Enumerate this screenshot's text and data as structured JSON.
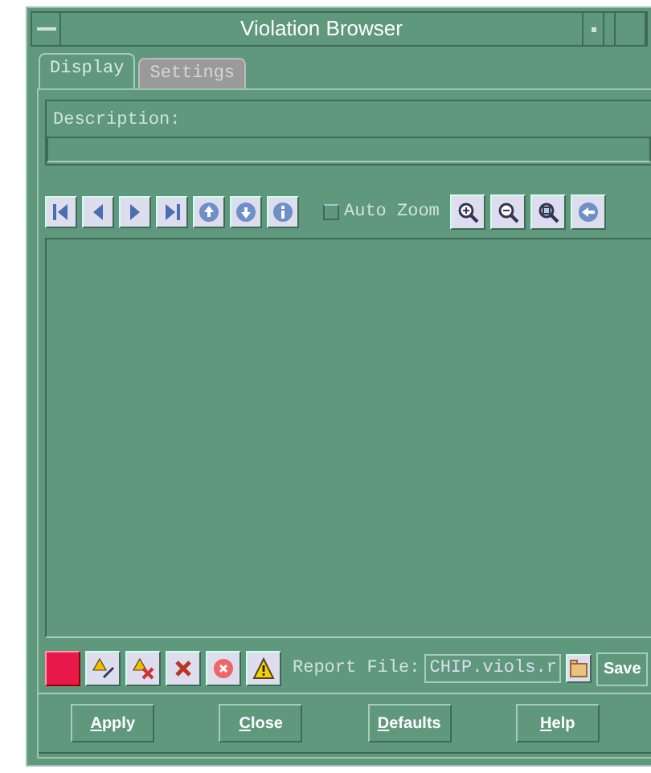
{
  "window": {
    "title": "Violation Browser"
  },
  "tabs": [
    {
      "label": "Display",
      "selected": true
    },
    {
      "label": "Settings",
      "selected": false
    }
  ],
  "description": {
    "label": "Description:"
  },
  "navigation_toolbar": {
    "auto_zoom": {
      "label": "Auto Zoom",
      "checked": false
    }
  },
  "violation_toolbar": {
    "color": "#e8194a",
    "report_file": {
      "label": "Report File:",
      "value": "CHIP.viols.r"
    },
    "save_button": "Save"
  },
  "buttons": [
    "Apply",
    "Close",
    "Defaults",
    "Help"
  ]
}
